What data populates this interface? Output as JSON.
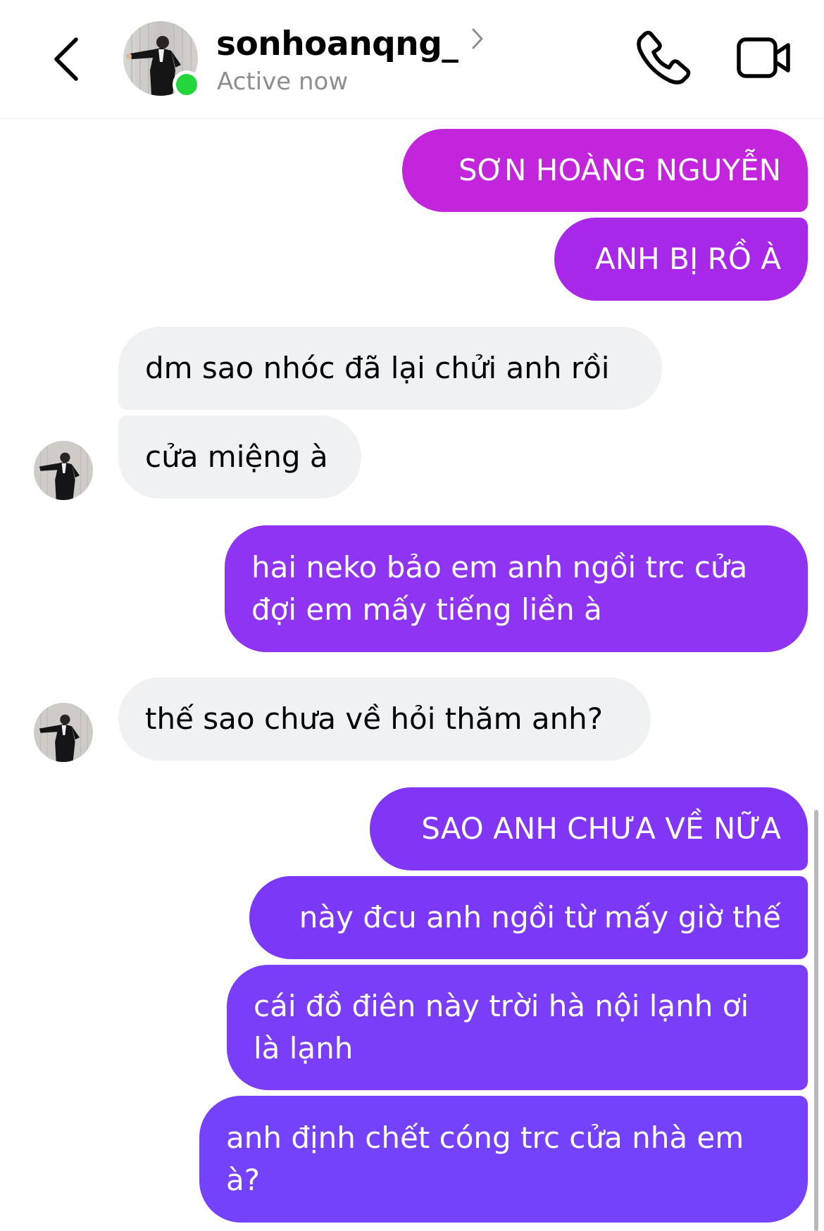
{
  "header": {
    "username": "sonhoanqng_",
    "status": "Active now",
    "back_icon": "chevron-left-icon",
    "call_icon": "phone-icon",
    "video_icon": "video-camera-icon",
    "online_color": "#22d63c"
  },
  "messages": [
    {
      "direction": "outgoing",
      "text": "SƠN HOÀNG NGUYỄN",
      "color": "#c225dc"
    },
    {
      "direction": "outgoing",
      "text": "ANH BỊ RỒ À",
      "color": "#a728e9"
    },
    {
      "direction": "incoming",
      "text": "dm sao nhóc đã lại chửi anh rồi"
    },
    {
      "direction": "incoming",
      "text": "cửa miệng à"
    },
    {
      "direction": "outgoing",
      "text": "hai neko bảo em anh ngồi trc cửa\nđợi em mấy tiếng liền à",
      "color": "#8e34f2"
    },
    {
      "direction": "incoming",
      "text": "thế sao chưa về hỏi thăm anh?"
    },
    {
      "direction": "outgoing",
      "text": "SAO ANH CHƯA VỀ NỮA",
      "color": "#8136f6"
    },
    {
      "direction": "outgoing",
      "text": "này đcu anh ngồi từ mấy giờ thế",
      "color": "#7b39f7"
    },
    {
      "direction": "outgoing",
      "text": "cái đồ điên này trời hà nội lạnh ơi\nlà lạnh",
      "color": "#7a3df8"
    },
    {
      "direction": "outgoing",
      "text": "anh định chết cóng trc cửa nhà em\nà?",
      "color": "#7442fa"
    }
  ]
}
